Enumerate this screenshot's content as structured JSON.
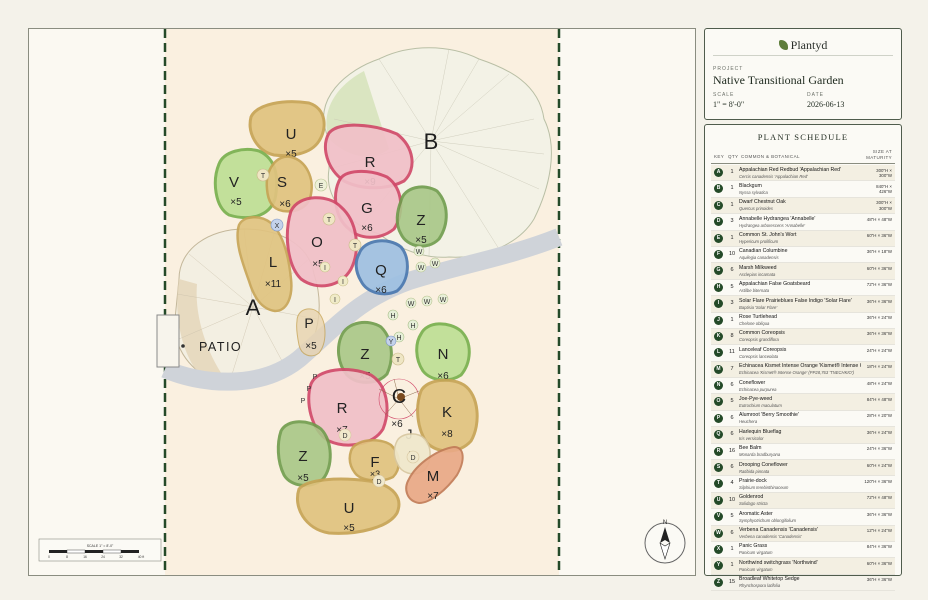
{
  "plan": {
    "patio_label": "PATIO",
    "scale_bar_caption": "SCALE 1\" = 8'-0\"",
    "scale_ticks": [
      "0",
      "8",
      "16",
      "24",
      "32",
      "40 ft"
    ],
    "compass_label": "N"
  },
  "title_block": {
    "brand": "Plantyd",
    "project_caption": "PROJECT",
    "project_name": "Native Transitional Garden",
    "scale_caption": "SCALE",
    "scale_value": "1\" = 8'-0\"",
    "date_caption": "DATE",
    "date_value": "2026-06-13"
  },
  "schedule": {
    "title": "PLANT SCHEDULE",
    "headers": {
      "key": "KEY",
      "qty": "QTY",
      "name": "COMMON & BOTANICAL",
      "size": "SIZE AT MATURITY"
    },
    "rows": [
      {
        "key": "A",
        "qty": "1",
        "common": "Appalachian Red Redbud 'Appalachian Red'",
        "botanical": "Cercis canadensis 'Appalachian Red'",
        "size": "300\"H × 300\"W"
      },
      {
        "key": "B",
        "qty": "1",
        "common": "Blackgum",
        "botanical": "Nyssa sylvatica",
        "size": "840\"H × 426\"W"
      },
      {
        "key": "C",
        "qty": "1",
        "common": "Dwarf Chestnut Oak",
        "botanical": "Quercus prinoides",
        "size": "300\"H × 300\"W"
      },
      {
        "key": "D",
        "qty": "3",
        "common": "Annabelle Hydrangea 'Annabelle'",
        "botanical": "Hydrangea arborescens 'Annabelle'",
        "size": "48\"H × 48\"W"
      },
      {
        "key": "E",
        "qty": "1",
        "common": "Common St. John's Wort",
        "botanical": "Hypericum prolificum",
        "size": "60\"H × 36\"W"
      },
      {
        "key": "F",
        "qty": "10",
        "common": "Canadian Columbine",
        "botanical": "Aquilegia canadensis",
        "size": "36\"H × 18\"W"
      },
      {
        "key": "G",
        "qty": "6",
        "common": "Marsh Milkweed",
        "botanical": "Asclepias incarnata",
        "size": "60\"H × 36\"W"
      },
      {
        "key": "H",
        "qty": "5",
        "common": "Appalachian False Goatsbeard",
        "botanical": "Astilbe biternata",
        "size": "72\"H × 36\"W"
      },
      {
        "key": "I",
        "qty": "3",
        "common": "Solar Flare Prairieblues False Indigo 'Solar Flare'",
        "botanical": "Baptisia 'Solar Flare'",
        "size": "36\"H × 36\"W"
      },
      {
        "key": "J",
        "qty": "1",
        "common": "Rose Turtlehead",
        "botanical": "Chelone obliqua",
        "size": "36\"H × 24\"W"
      },
      {
        "key": "K",
        "qty": "8",
        "common": "Common Coreopsis",
        "botanical": "Coreopsis grandiflora",
        "size": "36\"H × 36\"W"
      },
      {
        "key": "L",
        "qty": "11",
        "common": "Lanceleaf Coreopsis",
        "botanical": "Coreopsis lanceolata",
        "size": "24\"H × 24\"W"
      },
      {
        "key": "M",
        "qty": "7",
        "common": "Echinacea Kismet Intense Orange 'Kismet® Intense Orange'",
        "botanical": "Echinacea 'Kismet® Intense Orange' (PP28,763 'TNECHKIO')",
        "size": "18\"H × 24\"W"
      },
      {
        "key": "N",
        "qty": "6",
        "common": "Coneflower",
        "botanical": "Echinacea purpurea",
        "size": "48\"H × 24\"W"
      },
      {
        "key": "O",
        "qty": "5",
        "common": "Joe-Pye-weed",
        "botanical": "Eutrochium maculatum",
        "size": "84\"H × 48\"W"
      },
      {
        "key": "P",
        "qty": "6",
        "common": "Alumroot 'Berry Smoothie'",
        "botanical": "Heuchera",
        "size": "28\"H × 20\"W"
      },
      {
        "key": "Q",
        "qty": "6",
        "common": "Harlequin Blueflag",
        "botanical": "Iris versicolor",
        "size": "36\"H × 24\"W"
      },
      {
        "key": "R",
        "qty": "16",
        "common": "Bee Balm",
        "botanical": "Monarda bradburyana",
        "size": "24\"H × 36\"W"
      },
      {
        "key": "S",
        "qty": "6",
        "common": "Drooping Coneflower",
        "botanical": "Ratibida pinnata",
        "size": "60\"H × 24\"W"
      },
      {
        "key": "T",
        "qty": "4",
        "common": "Prairie-dock",
        "botanical": "Silphium terebinthinaceum",
        "size": "120\"H × 36\"W"
      },
      {
        "key": "U",
        "qty": "10",
        "common": "Goldenrod",
        "botanical": "Solidago stricta",
        "size": "72\"H × 48\"W"
      },
      {
        "key": "V",
        "qty": "5",
        "common": "Aromatic Aster",
        "botanical": "Symphyotrichum oblongifolium",
        "size": "36\"H × 36\"W"
      },
      {
        "key": "W",
        "qty": "6",
        "common": "Verbena Canadensis 'Canadensis'",
        "botanical": "Verbena canadensis 'Canadensis'",
        "size": "12\"H × 24\"W"
      },
      {
        "key": "X",
        "qty": "1",
        "common": "Panic Grass",
        "botanical": "Panicum virgatum",
        "size": "84\"H × 36\"W"
      },
      {
        "key": "Y",
        "qty": "1",
        "common": "Northwind switchgrass 'Northwind'",
        "botanical": "Panicum virgatum",
        "size": "60\"H × 36\"W"
      },
      {
        "key": "Z",
        "qty": "15",
        "common": "Broadleaf Whitetop Sedge",
        "botanical": "Rhynchospora latifolia",
        "size": "36\"H × 36\"W"
      }
    ]
  },
  "beds": [
    {
      "label": "U",
      "count": "×5"
    },
    {
      "label": "V",
      "count": "×5"
    },
    {
      "label": "S",
      "count": "×6"
    },
    {
      "label": "R",
      "count": "×9"
    },
    {
      "label": "G",
      "count": "×6"
    },
    {
      "label": "Z",
      "count": "×5"
    },
    {
      "label": "O",
      "count": "×5"
    },
    {
      "label": "Q",
      "count": "×6"
    },
    {
      "label": "L",
      "count": "×11"
    },
    {
      "label": "P",
      "count": "×5"
    },
    {
      "label": "Z",
      "count": "×5"
    },
    {
      "label": "N",
      "count": "×6"
    },
    {
      "label": "R",
      "count": "×7"
    },
    {
      "label": "J",
      "count": "×6"
    },
    {
      "label": "K",
      "count": "×8"
    },
    {
      "label": "Z",
      "count": "×5"
    },
    {
      "label": "F",
      "count": "×5"
    },
    {
      "label": "D",
      "count": "×3"
    },
    {
      "label": "M",
      "count": "×7"
    },
    {
      "label": "U",
      "count": "×5"
    }
  ],
  "trees": {
    "A": "A",
    "B": "B",
    "C": "C"
  },
  "markers": [
    "T",
    "E",
    "T",
    "X",
    "T",
    "W",
    "W",
    "W",
    "I",
    "I",
    "I",
    "H",
    "H",
    "H",
    "W",
    "W",
    "W",
    "Y",
    "T",
    "P",
    "P",
    "P",
    "D",
    "D",
    "D"
  ],
  "colors": {
    "frame": "#244a28",
    "path": "#cfd3d9",
    "badge": "#244a28"
  }
}
